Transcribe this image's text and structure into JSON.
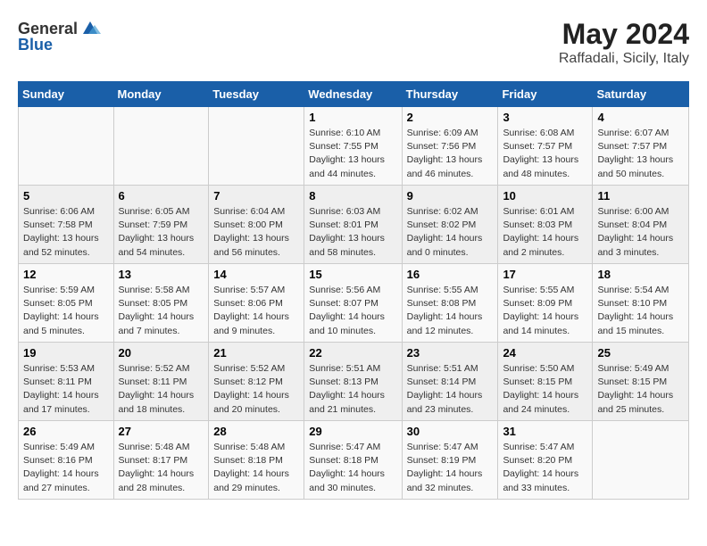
{
  "header": {
    "logo_general": "General",
    "logo_blue": "Blue",
    "month_year": "May 2024",
    "location": "Raffadali, Sicily, Italy"
  },
  "weekdays": [
    "Sunday",
    "Monday",
    "Tuesday",
    "Wednesday",
    "Thursday",
    "Friday",
    "Saturday"
  ],
  "weeks": [
    [
      {
        "day": "",
        "info": ""
      },
      {
        "day": "",
        "info": ""
      },
      {
        "day": "",
        "info": ""
      },
      {
        "day": "1",
        "info": "Sunrise: 6:10 AM\nSunset: 7:55 PM\nDaylight: 13 hours\nand 44 minutes."
      },
      {
        "day": "2",
        "info": "Sunrise: 6:09 AM\nSunset: 7:56 PM\nDaylight: 13 hours\nand 46 minutes."
      },
      {
        "day": "3",
        "info": "Sunrise: 6:08 AM\nSunset: 7:57 PM\nDaylight: 13 hours\nand 48 minutes."
      },
      {
        "day": "4",
        "info": "Sunrise: 6:07 AM\nSunset: 7:57 PM\nDaylight: 13 hours\nand 50 minutes."
      }
    ],
    [
      {
        "day": "5",
        "info": "Sunrise: 6:06 AM\nSunset: 7:58 PM\nDaylight: 13 hours\nand 52 minutes."
      },
      {
        "day": "6",
        "info": "Sunrise: 6:05 AM\nSunset: 7:59 PM\nDaylight: 13 hours\nand 54 minutes."
      },
      {
        "day": "7",
        "info": "Sunrise: 6:04 AM\nSunset: 8:00 PM\nDaylight: 13 hours\nand 56 minutes."
      },
      {
        "day": "8",
        "info": "Sunrise: 6:03 AM\nSunset: 8:01 PM\nDaylight: 13 hours\nand 58 minutes."
      },
      {
        "day": "9",
        "info": "Sunrise: 6:02 AM\nSunset: 8:02 PM\nDaylight: 14 hours\nand 0 minutes."
      },
      {
        "day": "10",
        "info": "Sunrise: 6:01 AM\nSunset: 8:03 PM\nDaylight: 14 hours\nand 2 minutes."
      },
      {
        "day": "11",
        "info": "Sunrise: 6:00 AM\nSunset: 8:04 PM\nDaylight: 14 hours\nand 3 minutes."
      }
    ],
    [
      {
        "day": "12",
        "info": "Sunrise: 5:59 AM\nSunset: 8:05 PM\nDaylight: 14 hours\nand 5 minutes."
      },
      {
        "day": "13",
        "info": "Sunrise: 5:58 AM\nSunset: 8:05 PM\nDaylight: 14 hours\nand 7 minutes."
      },
      {
        "day": "14",
        "info": "Sunrise: 5:57 AM\nSunset: 8:06 PM\nDaylight: 14 hours\nand 9 minutes."
      },
      {
        "day": "15",
        "info": "Sunrise: 5:56 AM\nSunset: 8:07 PM\nDaylight: 14 hours\nand 10 minutes."
      },
      {
        "day": "16",
        "info": "Sunrise: 5:55 AM\nSunset: 8:08 PM\nDaylight: 14 hours\nand 12 minutes."
      },
      {
        "day": "17",
        "info": "Sunrise: 5:55 AM\nSunset: 8:09 PM\nDaylight: 14 hours\nand 14 minutes."
      },
      {
        "day": "18",
        "info": "Sunrise: 5:54 AM\nSunset: 8:10 PM\nDaylight: 14 hours\nand 15 minutes."
      }
    ],
    [
      {
        "day": "19",
        "info": "Sunrise: 5:53 AM\nSunset: 8:11 PM\nDaylight: 14 hours\nand 17 minutes."
      },
      {
        "day": "20",
        "info": "Sunrise: 5:52 AM\nSunset: 8:11 PM\nDaylight: 14 hours\nand 18 minutes."
      },
      {
        "day": "21",
        "info": "Sunrise: 5:52 AM\nSunset: 8:12 PM\nDaylight: 14 hours\nand 20 minutes."
      },
      {
        "day": "22",
        "info": "Sunrise: 5:51 AM\nSunset: 8:13 PM\nDaylight: 14 hours\nand 21 minutes."
      },
      {
        "day": "23",
        "info": "Sunrise: 5:51 AM\nSunset: 8:14 PM\nDaylight: 14 hours\nand 23 minutes."
      },
      {
        "day": "24",
        "info": "Sunrise: 5:50 AM\nSunset: 8:15 PM\nDaylight: 14 hours\nand 24 minutes."
      },
      {
        "day": "25",
        "info": "Sunrise: 5:49 AM\nSunset: 8:15 PM\nDaylight: 14 hours\nand 25 minutes."
      }
    ],
    [
      {
        "day": "26",
        "info": "Sunrise: 5:49 AM\nSunset: 8:16 PM\nDaylight: 14 hours\nand 27 minutes."
      },
      {
        "day": "27",
        "info": "Sunrise: 5:48 AM\nSunset: 8:17 PM\nDaylight: 14 hours\nand 28 minutes."
      },
      {
        "day": "28",
        "info": "Sunrise: 5:48 AM\nSunset: 8:18 PM\nDaylight: 14 hours\nand 29 minutes."
      },
      {
        "day": "29",
        "info": "Sunrise: 5:47 AM\nSunset: 8:18 PM\nDaylight: 14 hours\nand 30 minutes."
      },
      {
        "day": "30",
        "info": "Sunrise: 5:47 AM\nSunset: 8:19 PM\nDaylight: 14 hours\nand 32 minutes."
      },
      {
        "day": "31",
        "info": "Sunrise: 5:47 AM\nSunset: 8:20 PM\nDaylight: 14 hours\nand 33 minutes."
      },
      {
        "day": "",
        "info": ""
      }
    ]
  ]
}
